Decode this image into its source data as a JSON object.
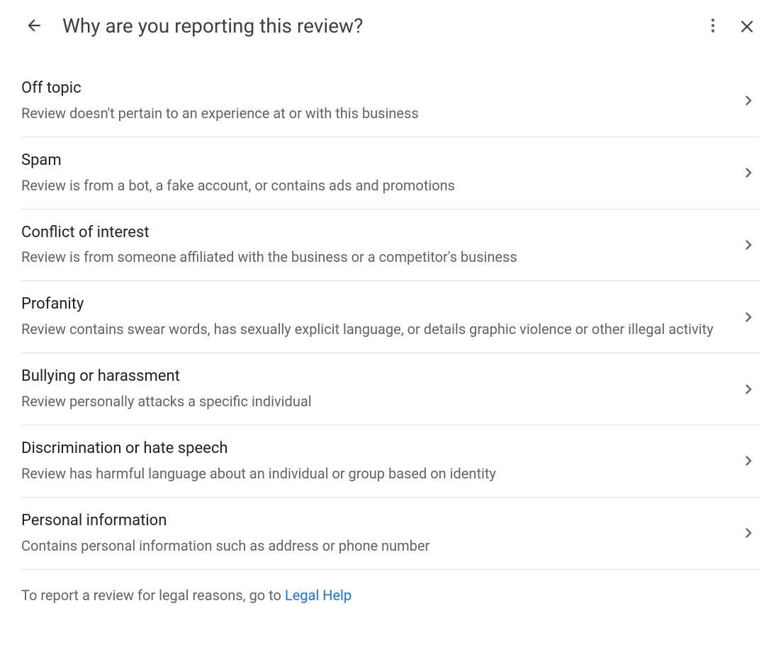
{
  "header": {
    "title": "Why are you reporting this review?"
  },
  "options": [
    {
      "title": "Off topic",
      "desc": "Review doesn't pertain to an experience at or with this business"
    },
    {
      "title": "Spam",
      "desc": "Review is from a bot, a fake account, or contains ads and promotions"
    },
    {
      "title": "Conflict of interest",
      "desc": "Review is from someone affiliated with the business or a competitor's business"
    },
    {
      "title": "Profanity",
      "desc": "Review contains swear words, has sexually explicit language, or details graphic violence or other illegal activity"
    },
    {
      "title": "Bullying or harassment",
      "desc": "Review personally attacks a specific individual"
    },
    {
      "title": "Discrimination or hate speech",
      "desc": "Review has harmful language about an individual or group based on identity"
    },
    {
      "title": "Personal information",
      "desc": "Contains personal information such as address or phone number"
    }
  ],
  "footer": {
    "prefix": "To report a review for legal reasons, go to ",
    "link_text": "Legal Help"
  }
}
